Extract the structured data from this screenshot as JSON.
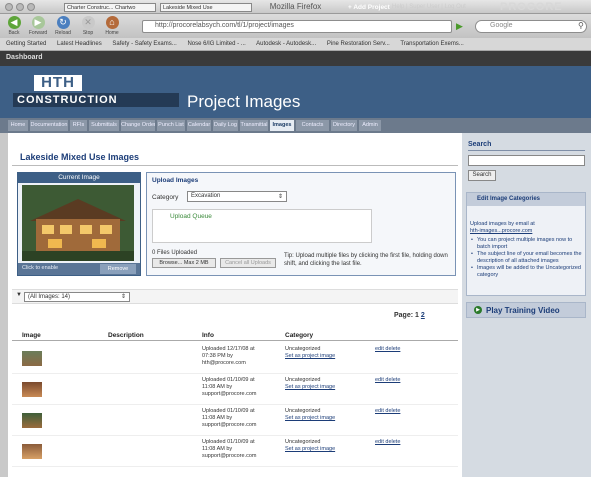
{
  "browser": {
    "window_title": "Mozilla Firefox",
    "nav": [
      {
        "label": "Back"
      },
      {
        "label": "Forward"
      },
      {
        "label": "Reload"
      },
      {
        "label": "Stop"
      },
      {
        "label": "Home"
      }
    ],
    "url": "http://procorelabsych.com/tl/1/project/images",
    "search_placeholder": "Google",
    "bookmarks": [
      "Getting Started",
      "Latest Headlines",
      "Safety - Safety Exams...",
      "Nose 6/IG Limited - ...",
      "Autodesk - Autodesk...",
      "Pine Restoration Serv...",
      "Transportation Exems..."
    ]
  },
  "appbar": {
    "dashboard": "Dashboard",
    "company_select": "Charter Construc... Chartwo",
    "project_select": "Lakeside Mixed Use",
    "add_project": "+ Add Project",
    "links": "Help | Super User | Log Out",
    "brand": "PROCORE"
  },
  "header": {
    "logo_top": "HTH",
    "logo_bottom": "CONSTRUCTION",
    "page_heading": "Project Images"
  },
  "tabs": [
    "Home",
    "Documentation",
    "RFIs",
    "Submittals",
    "Change Orders",
    "Punch List",
    "Calendar",
    "Daily Log",
    "Transmittal",
    "Images",
    "Contacts",
    "Directory",
    "Admin"
  ],
  "active_tab": "Images",
  "main": {
    "title": "Lakeside Mixed Use Images",
    "current_image": {
      "header": "Current Image",
      "caption": "Click to enable",
      "button": "Remove"
    },
    "upload": {
      "title": "Upload Images",
      "category_label": "Category",
      "category_value": "Excavation",
      "queue_title": "Upload Queue",
      "files_uploaded": "0 Files Uploaded",
      "browse_label": "Browse... Max 2 MB",
      "cancel_label": "Cancel all Uploads",
      "tip": "Tip: Upload multiple files by clicking the first file, holding down shift, and clicking the last file."
    },
    "filter": "(All Images: 14)",
    "pager_label": "Page:",
    "pager_current": "1",
    "pager_other": "2",
    "columns": [
      "Image",
      "Description",
      "Info",
      "Category"
    ],
    "rows": [
      {
        "info": [
          "Uploaded 12/17/08 at",
          "07:38 PM by",
          "hth@procore.com"
        ],
        "category": "Uncategorized",
        "link": "Set as project image",
        "actions": "edit delete"
      },
      {
        "info": [
          "Uploaded 01/10/09 at",
          "11:08 AM by",
          "support@procore.com"
        ],
        "category": "Uncategorized",
        "link": "Set as project image",
        "actions": "edit delete"
      },
      {
        "info": [
          "Uploaded 01/10/09 at",
          "11:08 AM by",
          "support@procore.com"
        ],
        "category": "Uncategorized",
        "link": "Set as project image",
        "actions": "edit delete"
      },
      {
        "info": [
          "Uploaded 01/10/09 at",
          "11:08 AM by",
          "support@procore.com"
        ],
        "category": "Uncategorized",
        "link": "Set as project image",
        "actions": "edit delete"
      }
    ]
  },
  "sidebar": {
    "search_title": "Search",
    "search_button": "Search",
    "categories_title": "Edit Image Categories",
    "categories_intro": "Upload images by email at",
    "categories_email": "hth-images...procore.com",
    "categories_bullets": [
      "You can project multiple images now to batch import",
      "The subject line of your email becomes the description of all attached images",
      "Images will be added to the Uncategorized category"
    ],
    "video_label": "Play Training Video"
  },
  "colors": {
    "header_blue": "#3d5f86",
    "link_blue": "#1c3d78",
    "chrome_dark": "#3a3a3a"
  }
}
